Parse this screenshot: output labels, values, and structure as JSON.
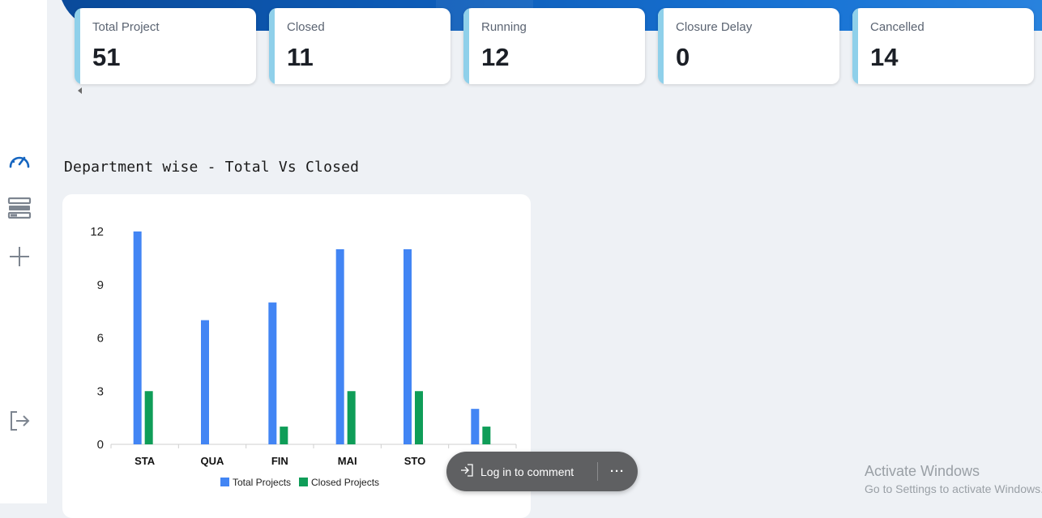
{
  "stats": [
    {
      "label": "Total Project",
      "value": "51"
    },
    {
      "label": "Closed",
      "value": "11"
    },
    {
      "label": "Running",
      "value": "12"
    },
    {
      "label": "Closure Delay",
      "value": "0"
    },
    {
      "label": "Cancelled",
      "value": "14"
    }
  ],
  "sidebar": {
    "icons": [
      "dashboard-gauge-icon",
      "list-icon",
      "add-icon",
      "logout-icon"
    ],
    "active_color": "#1565c0"
  },
  "section": {
    "title": "Department wise - Total Vs Closed"
  },
  "chart_data": {
    "type": "bar",
    "categories": [
      "STA",
      "QUA",
      "FIN",
      "MAI",
      "STO",
      ""
    ],
    "series": [
      {
        "name": "Total Projects",
        "values": [
          12,
          7,
          8,
          11,
          11,
          2
        ],
        "color": "#4285f4"
      },
      {
        "name": "Closed Projects",
        "values": [
          3,
          0,
          1,
          3,
          3,
          1
        ],
        "color": "#0f9d58"
      }
    ],
    "yticks": [
      "0",
      "3",
      "6",
      "9",
      "12"
    ],
    "ylim": [
      0,
      12
    ],
    "legend": "bottom"
  },
  "comment": {
    "label": "Log in to comment",
    "more": "···"
  },
  "watermark": {
    "title": "Activate Windows",
    "subtitle": "Go to Settings to activate Windows."
  }
}
